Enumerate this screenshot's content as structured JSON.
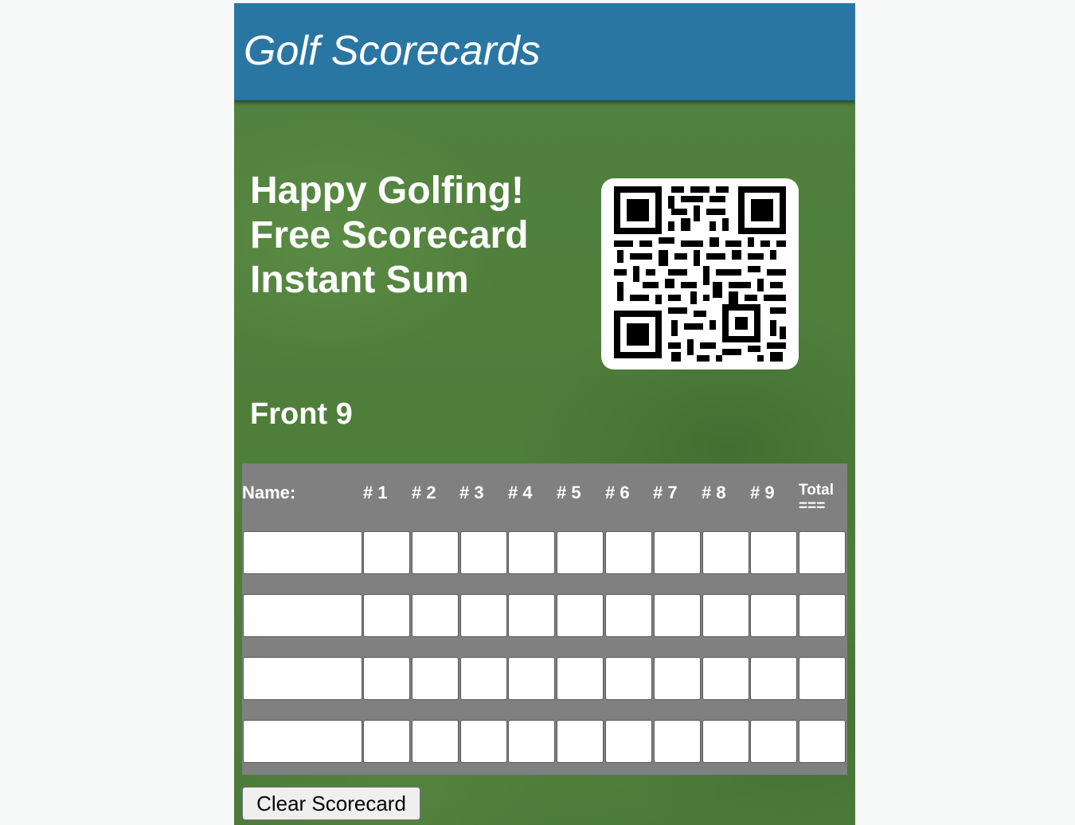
{
  "header": {
    "title": "Golf Scorecards",
    "color": "#2a76a3"
  },
  "hero": {
    "lines": [
      "Happy Golfing!",
      "Free Scorecard",
      "Instant Sum"
    ],
    "qr_icon": "qr-code-icon"
  },
  "section": {
    "title": "Front 9"
  },
  "table": {
    "name_header": "Name:",
    "holes": [
      "# 1",
      "# 2",
      "# 3",
      "# 4",
      "# 5",
      "# 6",
      "# 7",
      "# 8",
      "# 9"
    ],
    "total_header": "Total",
    "total_sub": "===",
    "rows": [
      {
        "name": "",
        "scores": [
          "",
          "",
          "",
          "",
          "",
          "",
          "",
          "",
          ""
        ],
        "total": ""
      },
      {
        "name": "",
        "scores": [
          "",
          "",
          "",
          "",
          "",
          "",
          "",
          "",
          ""
        ],
        "total": ""
      },
      {
        "name": "",
        "scores": [
          "",
          "",
          "",
          "",
          "",
          "",
          "",
          "",
          ""
        ],
        "total": ""
      },
      {
        "name": "",
        "scores": [
          "",
          "",
          "",
          "",
          "",
          "",
          "",
          "",
          ""
        ],
        "total": ""
      }
    ]
  },
  "buttons": {
    "clear_label": "Clear Scorecard"
  }
}
